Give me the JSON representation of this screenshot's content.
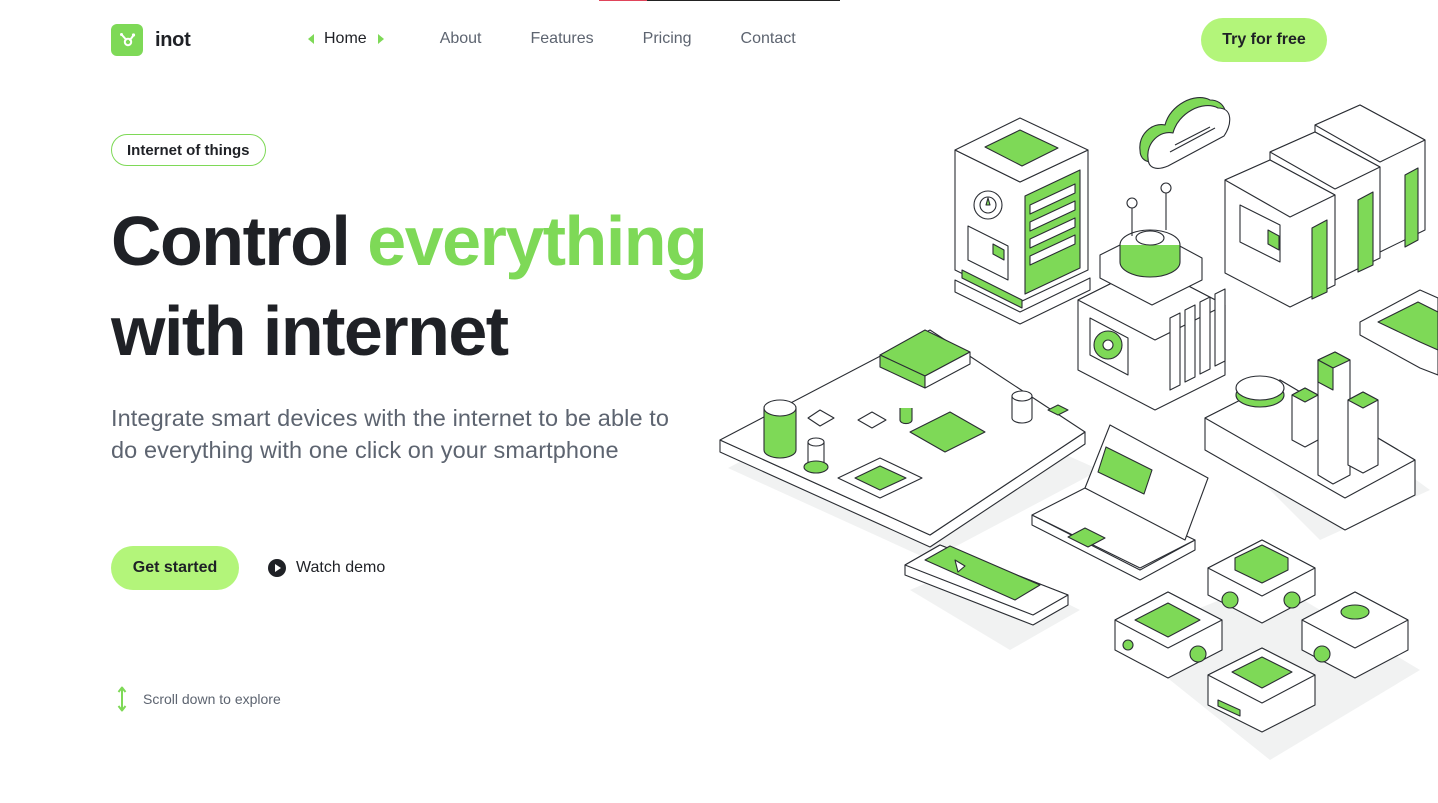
{
  "brand": {
    "name": "inot",
    "color": "#7ed957"
  },
  "nav": {
    "items": [
      {
        "label": "Home",
        "active": true
      },
      {
        "label": "About"
      },
      {
        "label": "Features"
      },
      {
        "label": "Pricing"
      },
      {
        "label": "Contact"
      }
    ],
    "cta_label": "Try for free"
  },
  "hero": {
    "badge": "Internet of things",
    "title_part1": "Control ",
    "title_accent": "everything",
    "title_part2": "with internet",
    "subtitle": "Integrate smart devices with the internet to be able to do everything with one click on your smartphone",
    "primary_button": "Get started",
    "secondary_button": "Watch demo",
    "scroll_hint": "Scroll down to explore"
  },
  "colors": {
    "accent": "#7ed957",
    "button": "#b3f57a",
    "text": "#1f2126",
    "muted": "#5d6470"
  },
  "icons": [
    "logo-mark-icon",
    "chevron-left-icon",
    "chevron-right-icon",
    "play-icon",
    "scroll-arrow-icon"
  ]
}
